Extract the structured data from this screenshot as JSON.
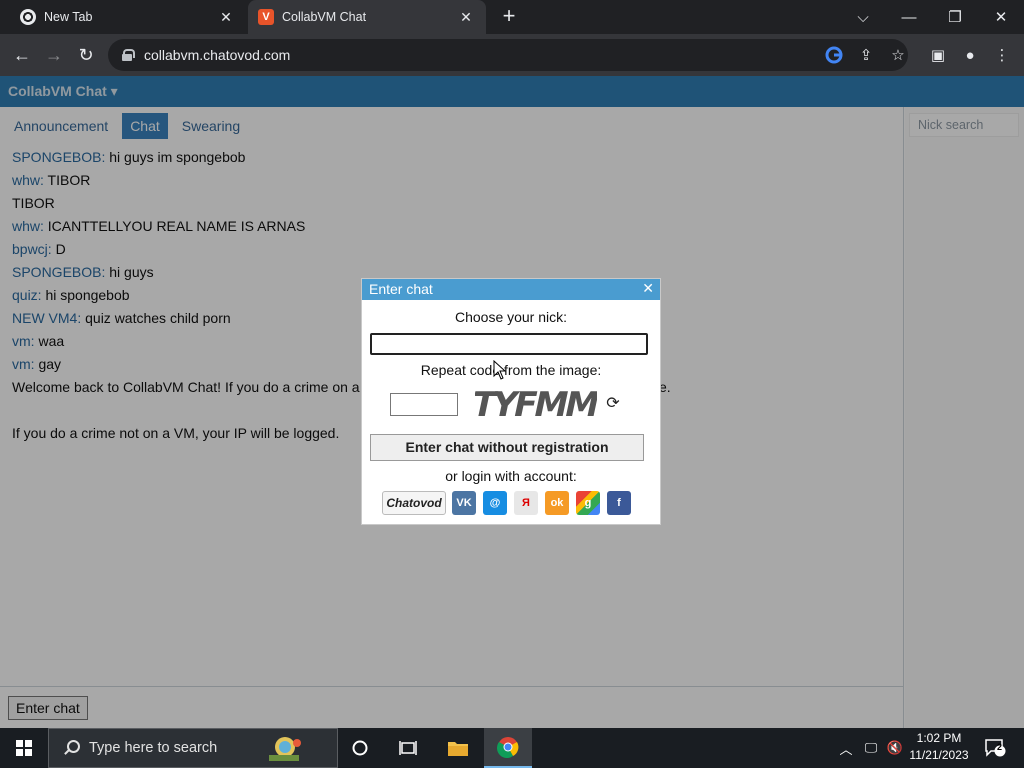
{
  "browser": {
    "tabs": [
      {
        "title": "New Tab"
      },
      {
        "title": "CollabVM Chat"
      }
    ],
    "url": "collabvm.chatovod.com"
  },
  "app": {
    "brand": "CollabVM Chat",
    "tabs": [
      "Announcement",
      "Chat",
      "Swearing"
    ],
    "active_tab": "Chat",
    "messages": [
      {
        "nick": "SPONGEBOB:",
        "text": "hi guys im spongebob"
      },
      {
        "nick": "whw:",
        "text": "TIBOR"
      },
      {
        "nick": "",
        "text": "TIBOR"
      },
      {
        "nick": "whw:",
        "text": "ICANTTELLYOU REAL NAME IS ARNAS"
      },
      {
        "nick": "bpwcj:",
        "text": "D"
      },
      {
        "nick": "SPONGEBOB:",
        "text": "hi guys"
      },
      {
        "nick": "quiz:",
        "text": "hi spongebob"
      },
      {
        "nick": "NEW VM4:",
        "text": "quiz watches child porn"
      },
      {
        "nick": "vm:",
        "text": "waa"
      },
      {
        "nick": "vm:",
        "text": "gay"
      }
    ],
    "system_line_1_start": "Welcome back to CollabVM Chat! If you do a crime on a VM,",
    "system_line_1_end": "e.",
    "system_line_2": "If you do a crime not on a VM, your IP will be logged.",
    "enter_chat_button": "Enter chat",
    "nick_search_placeholder": "Nick search"
  },
  "dialog": {
    "title": "Enter chat",
    "choose_nick_label": "Choose your nick:",
    "nick_value": "",
    "repeat_code_label": "Repeat code from the image:",
    "captcha_text": "TYFMM",
    "guest_button": "Enter chat without registration",
    "login_label": "or login with account:",
    "login_services": [
      {
        "name": "Chatovod",
        "label": "Chatovod",
        "color": "#f5f5f5"
      },
      {
        "name": "vk",
        "label": "VK",
        "color": "#4c75a3"
      },
      {
        "name": "mail-ru",
        "label": "@",
        "color": "#168de2"
      },
      {
        "name": "yandex",
        "label": "Я",
        "color": "#e7e7e7"
      },
      {
        "name": "odnoklassniki",
        "label": "ok",
        "color": "#f59a25"
      },
      {
        "name": "google",
        "label": "g",
        "color": "#4aa34f"
      },
      {
        "name": "facebook",
        "label": "f",
        "color": "#3b5998"
      }
    ]
  },
  "taskbar": {
    "search_placeholder": "Type here to search",
    "time": "1:02 PM",
    "date": "11/21/2023",
    "notification_count": "2"
  }
}
